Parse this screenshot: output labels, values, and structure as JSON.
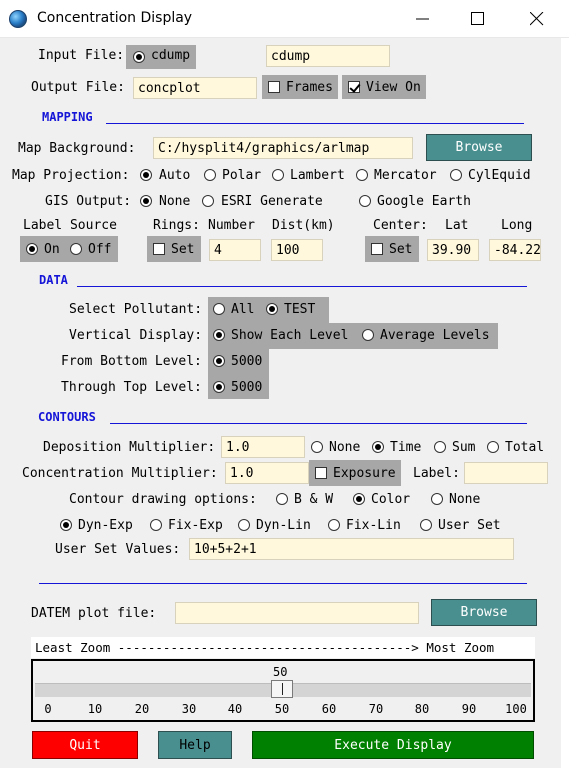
{
  "window": {
    "title": "Concentration Display",
    "buttons": {
      "minimize": "—",
      "maximize": "☐",
      "close": "✕"
    }
  },
  "input_file": {
    "label": "Input File:",
    "radio_label": "cdump",
    "radio_selected": true,
    "value": "cdump"
  },
  "output_file": {
    "label": "Output File:",
    "value": "concplot",
    "frames_label": "Frames",
    "frames_checked": false,
    "view_on_label": "View On",
    "view_on_checked": true
  },
  "mapping": {
    "heading": "MAPPING",
    "map_background_label": "Map Background:",
    "map_background_value": "C:/hysplit4/graphics/arlmap",
    "browse_label": "Browse",
    "projection_label": "Map Projection:",
    "projections": [
      {
        "label": "Auto",
        "selected": true
      },
      {
        "label": "Polar",
        "selected": false
      },
      {
        "label": "Lambert",
        "selected": false
      },
      {
        "label": "Mercator",
        "selected": false
      },
      {
        "label": "CylEquid",
        "selected": false
      }
    ],
    "gis_label": "GIS Output:",
    "gis_options": [
      {
        "label": "None",
        "selected": true
      },
      {
        "label": "ESRI Generate",
        "selected": false
      },
      {
        "label": "Google Earth",
        "selected": false
      }
    ],
    "label_source": {
      "title": "Label Source",
      "on_label": "On",
      "off_label": "Off",
      "on_selected": true
    },
    "rings": {
      "title": "Rings:",
      "number_title": "Number",
      "dist_title": "Dist(km)",
      "set_label": "Set",
      "set_checked": false,
      "number": "4",
      "dist": "100"
    },
    "center": {
      "title": "Center:",
      "lat_title": "Lat",
      "long_title": "Long",
      "set_label": "Set",
      "set_checked": false,
      "lat": "39.90",
      "long": "-84.22"
    }
  },
  "data": {
    "heading": "DATA",
    "pollutant_label": "Select Pollutant:",
    "pollutant_options": [
      {
        "label": "All",
        "selected": false
      },
      {
        "label": "TEST",
        "selected": true
      }
    ],
    "vertical_label": "Vertical Display:",
    "vertical_options": [
      {
        "label": "Show Each Level",
        "selected": true
      },
      {
        "label": "Average Levels",
        "selected": false
      }
    ],
    "from_bottom_label": "From Bottom Level:",
    "from_bottom_value": "5000",
    "through_top_label": "Through Top Level:",
    "through_top_value": "5000"
  },
  "contours": {
    "heading": "CONTOURS",
    "deposition_label": "Deposition Multiplier:",
    "deposition_value": "1.0",
    "deposition_options": [
      {
        "label": "None",
        "selected": false
      },
      {
        "label": "Time",
        "selected": true
      },
      {
        "label": "Sum",
        "selected": false
      },
      {
        "label": "Total",
        "selected": false
      }
    ],
    "concentration_label": "Concentration Multiplier:",
    "concentration_value": "1.0",
    "exposure_label": "Exposure",
    "exposure_checked": false,
    "label_label": "Label:",
    "label_value": "",
    "drawing_label": "Contour drawing options:",
    "drawing_options": [
      {
        "label": "B & W",
        "selected": false
      },
      {
        "label": "Color",
        "selected": true
      },
      {
        "label": "None",
        "selected": false
      }
    ],
    "scale_options": [
      {
        "label": "Dyn-Exp",
        "selected": true
      },
      {
        "label": "Fix-Exp",
        "selected": false
      },
      {
        "label": "Dyn-Lin",
        "selected": false
      },
      {
        "label": "Fix-Lin",
        "selected": false
      },
      {
        "label": "User Set",
        "selected": false
      }
    ],
    "user_set_label": "User Set Values:",
    "user_set_value": "10+5+2+1"
  },
  "datem": {
    "label": "DATEM plot file:",
    "value": "",
    "browse_label": "Browse"
  },
  "zoom": {
    "caption": "Least Zoom ---------------------------------------> Most Zoom",
    "value": 50,
    "value_label": "50",
    "ticks": [
      "0",
      "10",
      "20",
      "30",
      "40",
      "50",
      "60",
      "70",
      "80",
      "90",
      "100"
    ]
  },
  "footer": {
    "quit_label": "Quit",
    "help_label": "Help",
    "execute_label": "Execute Display",
    "colors": {
      "quit": "#ff0000",
      "help": "#4a8f8f",
      "execute": "#008000"
    }
  }
}
